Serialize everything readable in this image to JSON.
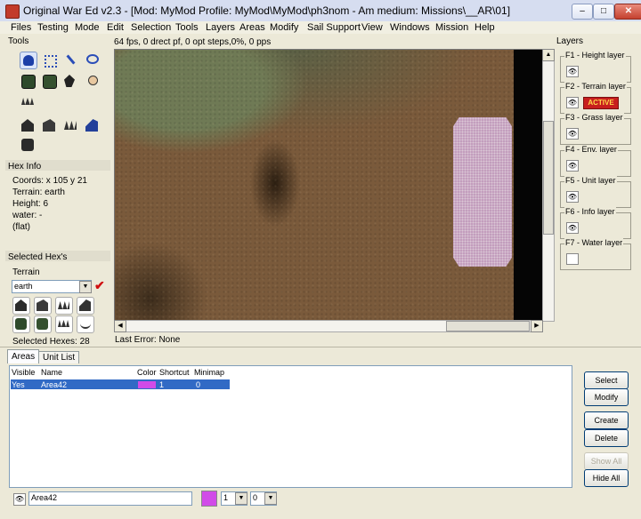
{
  "window": {
    "title": "Original War Ed v2.3 - [Mod: MyMod Profile: MyMod\\MyMod\\ph3nom - Am medium: Missions\\__AR\\01]",
    "minimize_glyph": "–",
    "maximize_glyph": "□",
    "close_glyph": "✕"
  },
  "menu": [
    "Files",
    "Testing",
    "Mode",
    "Edit",
    "Selection",
    "Tools",
    "Layers",
    "Areas",
    "Modify",
    "Sail Support",
    "View",
    "Windows",
    "Mission",
    "Help"
  ],
  "left": {
    "tools_label": "Tools",
    "hexinfo_label": "Hex Info",
    "hexinfo": {
      "coords": "Coords: x 105 y 21",
      "terrain": "Terrain: earth",
      "height": "Height: 6",
      "water": "water: -",
      "flat": "(flat)"
    },
    "selected_label": "Selected Hex's",
    "terrain_label": "Terrain",
    "terrain_value": "earth",
    "selected_count": "Selected Hexes: 28"
  },
  "status": {
    "fps": "64 fps, 0 drect pf, 0 opt steps,0%, 0 pps",
    "last_error": "Last Error: None"
  },
  "layers": {
    "label": "Layers",
    "items": [
      {
        "label": "F1 - Height layer"
      },
      {
        "label": "F2 - Terrain layer",
        "badge": "ACTIVE"
      },
      {
        "label": "F3 - Grass layer"
      },
      {
        "label": "F4 - Env. layer"
      },
      {
        "label": "F5 - Unit layer"
      },
      {
        "label": "F6 - Info layer"
      },
      {
        "label": "F7 - Water layer"
      }
    ]
  },
  "tabs": [
    "Areas",
    "Unit List"
  ],
  "areas_table": {
    "columns": [
      "Visible",
      "Name",
      "Color",
      "Shortcut",
      "Minimap"
    ],
    "rows": [
      {
        "visible": "Yes",
        "name": "Area42",
        "color": "#D14BE8",
        "shortcut": "1",
        "minimap": "0"
      }
    ]
  },
  "buttons": {
    "select": "Select",
    "modify": "Modify",
    "create": "Create",
    "delete": "Delete",
    "show_all": "Show All",
    "hide_all": "Hide All"
  },
  "bottom_bar": {
    "name_value": "Area42",
    "color": "#D14BE8",
    "shortcut_value": "1",
    "minimap_value": "0"
  },
  "icons": {
    "eye": "👁",
    "check": "✔",
    "drop": "▼",
    "left": "◀",
    "right": "▶",
    "up": "▲",
    "down": "▼"
  }
}
